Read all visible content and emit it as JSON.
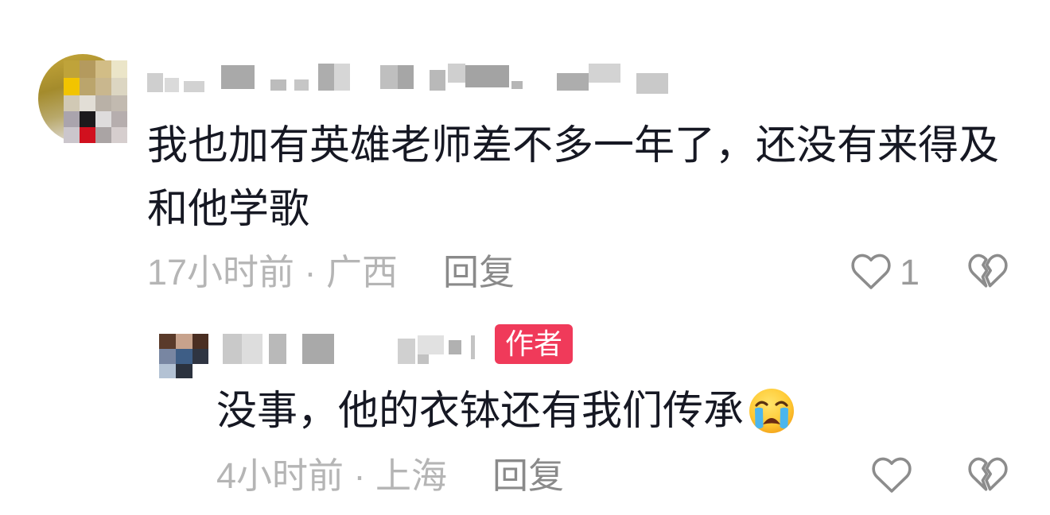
{
  "comment": {
    "text": "我也加有英雄老师差不多一年了，还没有来得及和他学歌",
    "meta": "17小时前 · 广西",
    "reply_label": "回复",
    "like_count": "1",
    "like_icon": "heart-outline-icon",
    "dislike_icon": "broken-heart-icon"
  },
  "reply": {
    "author_badge": "作者",
    "text": "没事，他的衣钵还有我们传承",
    "emoji_icon": "loudly-crying-face-emoji",
    "meta": "4小时前 · 上海",
    "reply_label": "回复",
    "like_icon": "heart-outline-icon",
    "dislike_icon": "broken-heart-icon"
  },
  "colors": {
    "background": "#ffffff",
    "primary_text": "#161823",
    "secondary_text": "#b5b5b5",
    "action_text": "#8a8a8a",
    "icon": "#8c8c8c",
    "like_count": "#9a9a9a",
    "author_badge": "#f03a5a",
    "author_badge_text": "#ffffff"
  }
}
